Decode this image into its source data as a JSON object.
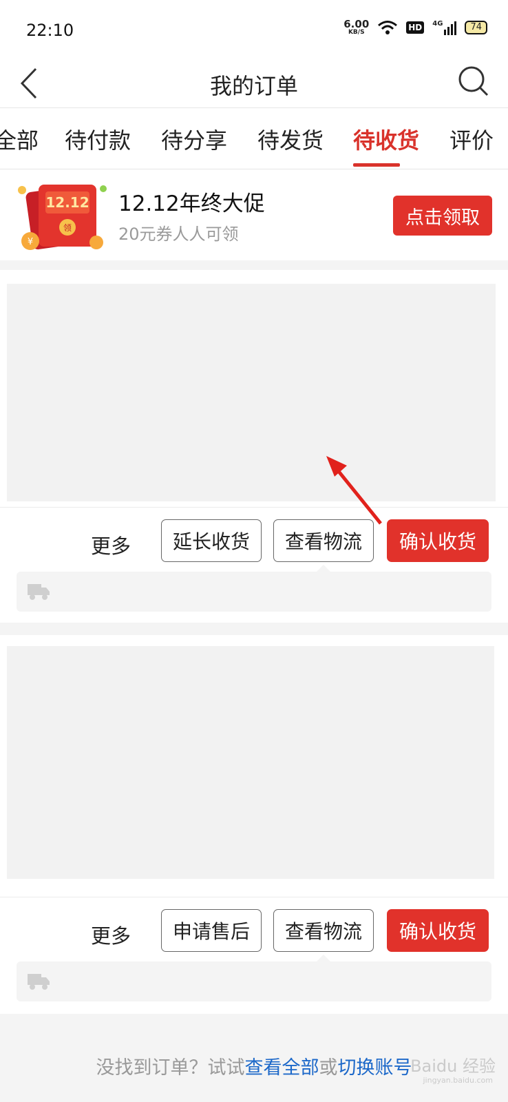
{
  "status_bar": {
    "time": "22:10",
    "net_speed_value": "6.00",
    "net_speed_unit": "KB/S",
    "hd": "HD",
    "network": "4G",
    "battery": "74"
  },
  "nav": {
    "title": "我的订单",
    "back_icon": "chevron-left-icon",
    "search_icon": "search-icon"
  },
  "tabs": [
    {
      "label": "全部"
    },
    {
      "label": "待付款"
    },
    {
      "label": "待分享"
    },
    {
      "label": "待发货"
    },
    {
      "label": "待收货",
      "active": true
    },
    {
      "label": "评价"
    }
  ],
  "promo": {
    "badge_text": "12.12",
    "seal_text": "领",
    "coin_text": "¥",
    "title": "12.12年终大促",
    "subtitle": "20元券人人可领",
    "button": "点击领取"
  },
  "orders": [
    {
      "more": "更多",
      "buttons": [
        "延长收货",
        "查看物流"
      ],
      "primary": "确认收货"
    },
    {
      "more": "更多",
      "buttons": [
        "申请售后",
        "查看物流"
      ],
      "primary": "确认收货"
    }
  ],
  "footer": {
    "prefix": "没找到订单？试试",
    "link1": "查看全部",
    "middle": "或",
    "link2": "切换账号"
  },
  "watermark": {
    "text": "Baidu 经验",
    "sub": "jingyan.baidu.com"
  },
  "colors": {
    "accent": "#e1322b",
    "link": "#1c68c9"
  }
}
